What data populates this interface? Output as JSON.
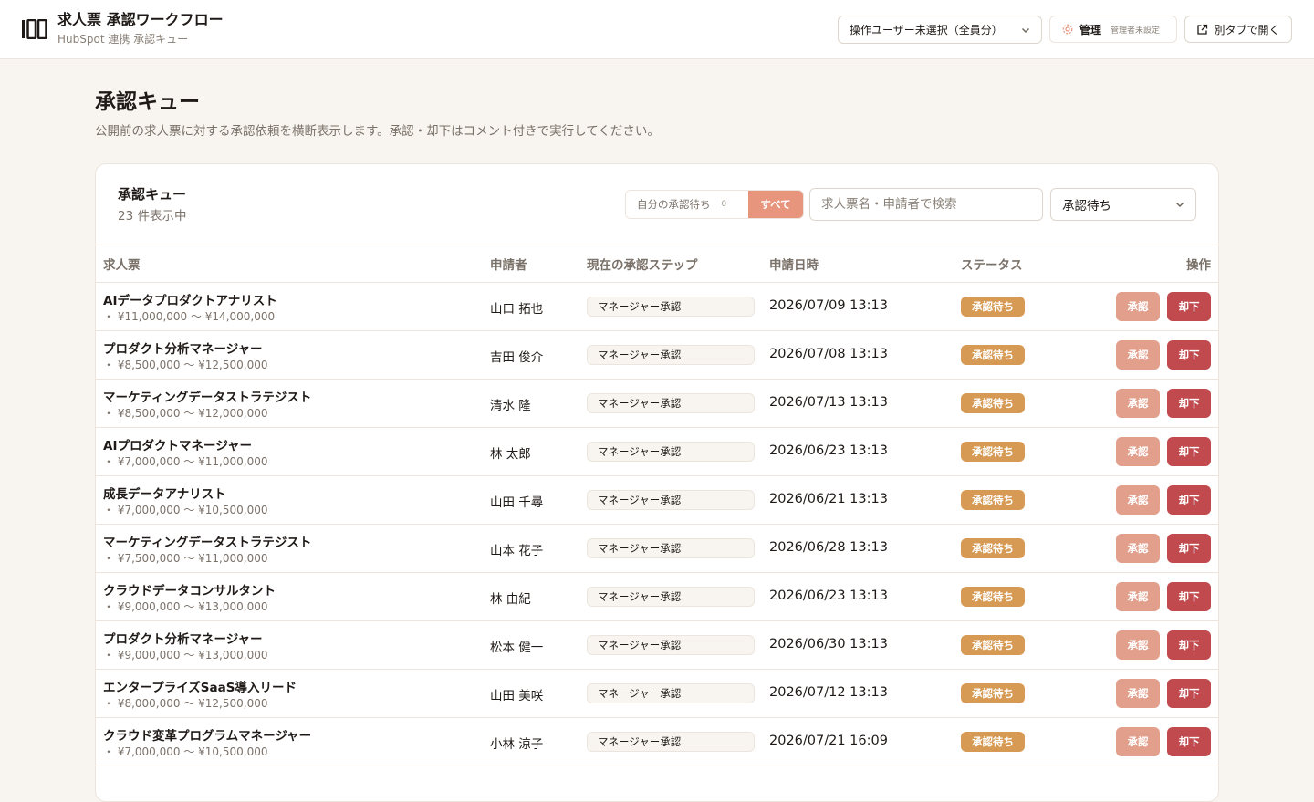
{
  "app": {
    "title": "求人票 承認ワークフロー",
    "subtitle": "HubSpot 連携 承認キュー"
  },
  "topbar": {
    "user_select": "操作ユーザー未選択（全員分）",
    "admin_label": "管理",
    "admin_sub": "管理者未設定",
    "open_newtab": "別タブで開く"
  },
  "page": {
    "title": "承認キュー",
    "description": "公開前の求人票に対する承認依頼を横断表示します。承認・却下はコメント付きで実行してください。"
  },
  "card": {
    "title": "承認キュー",
    "count": "23 件表示中",
    "filter_mine": "自分の承認待ち",
    "filter_mine_count": "0",
    "filter_all": "すべて",
    "search_placeholder": "求人票名・申請者で検索",
    "status_filter": "承認待ち"
  },
  "table": {
    "headers": {
      "job": "求人票",
      "applicant": "申請者",
      "step": "現在の承認ステップ",
      "date": "申請日時",
      "status": "ステータス",
      "actions": "操作"
    },
    "approve_label": "承認",
    "reject_label": "却下",
    "rows": [
      {
        "name": "AIデータプロダクトアナリスト",
        "salary": "・ ¥11,000,000 〜 ¥14,000,000",
        "applicant": "山口 拓也",
        "step": "マネージャー承認",
        "date": "2026/07/09 13:13",
        "status": "承認待ち"
      },
      {
        "name": "プロダクト分析マネージャー",
        "salary": "・ ¥8,500,000 〜 ¥12,500,000",
        "applicant": "吉田 俊介",
        "step": "マネージャー承認",
        "date": "2026/07/08 13:13",
        "status": "承認待ち"
      },
      {
        "name": "マーケティングデータストラテジスト",
        "salary": "・ ¥8,500,000 〜 ¥12,000,000",
        "applicant": "清水 隆",
        "step": "マネージャー承認",
        "date": "2026/07/13 13:13",
        "status": "承認待ち"
      },
      {
        "name": "AIプロダクトマネージャー",
        "salary": "・ ¥7,000,000 〜 ¥11,000,000",
        "applicant": "林 太郎",
        "step": "マネージャー承認",
        "date": "2026/06/23 13:13",
        "status": "承認待ち"
      },
      {
        "name": "成長データアナリスト",
        "salary": "・ ¥7,000,000 〜 ¥10,500,000",
        "applicant": "山田 千尋",
        "step": "マネージャー承認",
        "date": "2026/06/21 13:13",
        "status": "承認待ち"
      },
      {
        "name": "マーケティングデータストラテジスト",
        "salary": "・ ¥7,500,000 〜 ¥11,000,000",
        "applicant": "山本 花子",
        "step": "マネージャー承認",
        "date": "2026/06/28 13:13",
        "status": "承認待ち"
      },
      {
        "name": "クラウドデータコンサルタント",
        "salary": "・ ¥9,000,000 〜 ¥13,000,000",
        "applicant": "林 由紀",
        "step": "マネージャー承認",
        "date": "2026/06/23 13:13",
        "status": "承認待ち"
      },
      {
        "name": "プロダクト分析マネージャー",
        "salary": "・ ¥9,000,000 〜 ¥13,000,000",
        "applicant": "松本 健一",
        "step": "マネージャー承認",
        "date": "2026/06/30 13:13",
        "status": "承認待ち"
      },
      {
        "name": "エンタープライズSaaS導入リード",
        "salary": "・ ¥8,000,000 〜 ¥12,500,000",
        "applicant": "山田 美咲",
        "step": "マネージャー承認",
        "date": "2026/07/12 13:13",
        "status": "承認待ち"
      },
      {
        "name": "クラウド変革プログラムマネージャー",
        "salary": "・ ¥7,000,000 〜 ¥10,500,000",
        "applicant": "小林 涼子",
        "step": "マネージャー承認",
        "date": "2026/07/21 16:09",
        "status": "承認待ち"
      }
    ]
  },
  "icons": {
    "logo": "logo-icon",
    "chevron": "chevron-down-icon",
    "gear": "gear-icon",
    "external": "external-link-icon"
  },
  "colors": {
    "accent": "#e8957e",
    "status_pending": "#d79a54",
    "approve": "#e2a08c",
    "reject": "#c04a4d",
    "background": "#f8f5f0"
  }
}
